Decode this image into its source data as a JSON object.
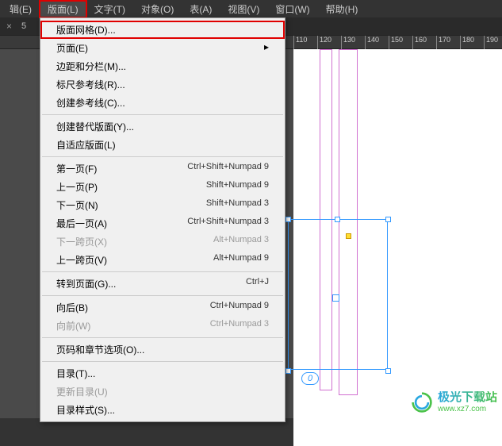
{
  "menubar": {
    "items": [
      "辑(E)",
      "版面(L)",
      "文字(T)",
      "对象(O)",
      "表(A)",
      "视图(V)",
      "窗口(W)",
      "帮助(H)"
    ],
    "active_index": 1
  },
  "tabbar": {
    "close": "×",
    "count": "5"
  },
  "ruler": {
    "ticks": [
      110,
      120,
      130,
      140,
      150,
      160,
      170,
      180,
      190
    ]
  },
  "dropdown": [
    {
      "label": "版面网格(D)...",
      "type": "item",
      "highlighted": true
    },
    {
      "label": "页面(E)",
      "type": "sub"
    },
    {
      "label": "边距和分栏(M)...",
      "type": "item"
    },
    {
      "label": "标尺参考线(R)...",
      "type": "item"
    },
    {
      "label": "创建参考线(C)...",
      "type": "item"
    },
    {
      "type": "sep"
    },
    {
      "label": "创建替代版面(Y)...",
      "type": "item"
    },
    {
      "label": "自适应版面(L)",
      "type": "item"
    },
    {
      "type": "sep"
    },
    {
      "label": "第一页(F)",
      "shortcut": "Ctrl+Shift+Numpad 9",
      "type": "item"
    },
    {
      "label": "上一页(P)",
      "shortcut": "Shift+Numpad 9",
      "type": "item"
    },
    {
      "label": "下一页(N)",
      "shortcut": "Shift+Numpad 3",
      "type": "item"
    },
    {
      "label": "最后一页(A)",
      "shortcut": "Ctrl+Shift+Numpad 3",
      "type": "item"
    },
    {
      "label": "下一跨页(X)",
      "shortcut": "Alt+Numpad 3",
      "type": "item",
      "disabled": true
    },
    {
      "label": "上一跨页(V)",
      "shortcut": "Alt+Numpad 9",
      "type": "item"
    },
    {
      "type": "sep"
    },
    {
      "label": "转到页面(G)...",
      "shortcut": "Ctrl+J",
      "type": "item"
    },
    {
      "type": "sep"
    },
    {
      "label": "向后(B)",
      "shortcut": "Ctrl+Numpad 9",
      "type": "item"
    },
    {
      "label": "向前(W)",
      "shortcut": "Ctrl+Numpad 3",
      "type": "item",
      "disabled": true
    },
    {
      "type": "sep"
    },
    {
      "label": "页码和章节选项(O)...",
      "type": "item"
    },
    {
      "type": "sep"
    },
    {
      "label": "目录(T)...",
      "type": "item"
    },
    {
      "label": "更新目录(U)",
      "type": "item",
      "disabled": true
    },
    {
      "label": "目录样式(S)...",
      "type": "item"
    }
  ],
  "canvas": {
    "zero": "0"
  },
  "logo": {
    "cn": "极光下载站",
    "url": "www.xz7.com"
  }
}
